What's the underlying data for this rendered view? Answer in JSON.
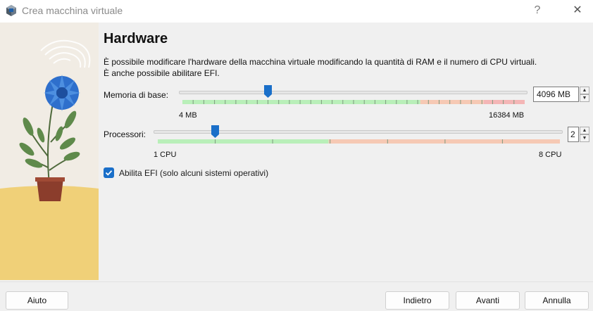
{
  "window": {
    "title": "Crea macchina virtuale",
    "help_label": "?",
    "close_label": "✕"
  },
  "page": {
    "heading": "Hardware",
    "description": "È possibile modificare l'hardware della macchina virtuale modificando la quantità di RAM e il numero di CPU virtuali. È anche possibile abilitare EFI."
  },
  "memory": {
    "label": "Memoria di base:",
    "value": "4096 MB",
    "value_mb": 4096,
    "min_label": "4 MB",
    "max_label": "16384 MB",
    "min_mb": 4,
    "max_mb": 16384
  },
  "processors": {
    "label": "Processori:",
    "value": "2",
    "value_num": 2,
    "min_label": "1 CPU",
    "max_label": "8 CPU",
    "min": 1,
    "max": 8
  },
  "efi": {
    "label": "Abilita EFI (solo alcuni sistemi operativi)",
    "checked": true
  },
  "buttons": {
    "help": "Aiuto",
    "back": "Indietro",
    "next": "Avanti",
    "cancel": "Annulla"
  },
  "colors": {
    "accent": "#1a6fc9",
    "scale_ok": "#b9efb9",
    "scale_warn": "#f6c9b4",
    "scale_bad": "#f4b6b6"
  }
}
